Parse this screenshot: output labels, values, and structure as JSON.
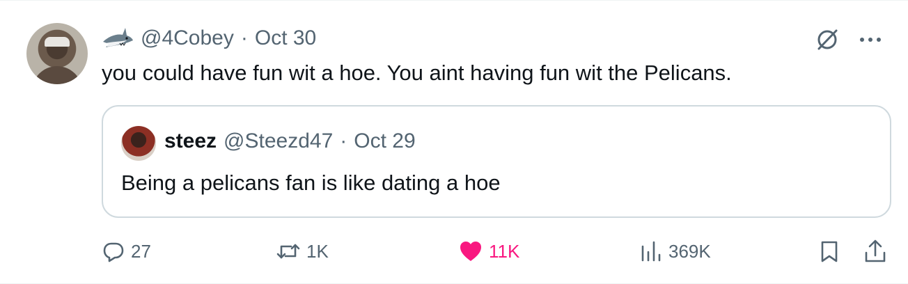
{
  "tweet": {
    "handle": "@4Cobey",
    "separator": "·",
    "date": "Oct 30",
    "text": "you could have fun wit a hoe. You aint having fun wit the Pelicans."
  },
  "quoted_tweet": {
    "name": "steez",
    "handle": "@Steezd47",
    "separator": "·",
    "date": "Oct 29",
    "text": "Being a pelicans fan is like dating a hoe"
  },
  "actions": {
    "replies": "27",
    "reposts": "1K",
    "likes": "11K",
    "views": "369K"
  },
  "colors": {
    "text_primary": "#0f1419",
    "text_secondary": "#536471",
    "like_pink": "#f91880",
    "border": "#cfd9de"
  },
  "icons": {
    "badge": "shark-icon",
    "grok": "grok-icon",
    "more": "more-icon",
    "reply": "reply-icon",
    "repost": "repost-icon",
    "like": "heart-icon",
    "views": "views-icon",
    "bookmark": "bookmark-icon",
    "share": "share-icon"
  }
}
